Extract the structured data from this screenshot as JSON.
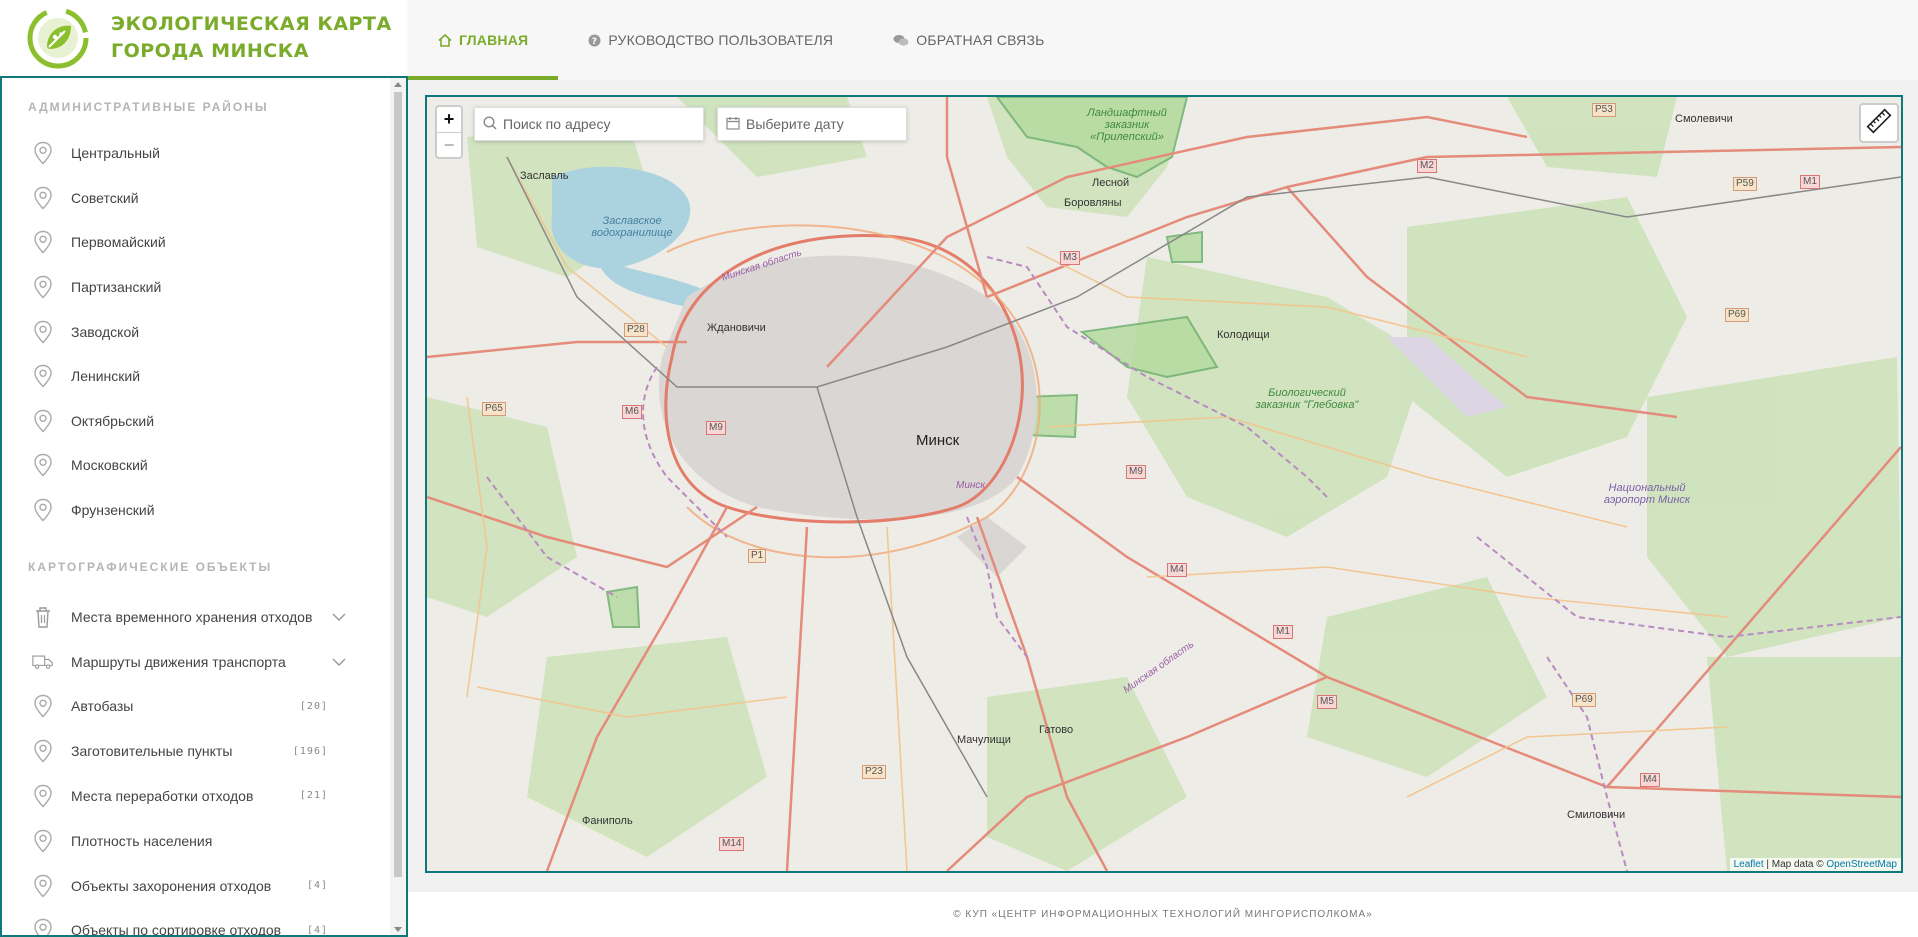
{
  "brand": {
    "title_line1": "ЭКОЛОГИЧЕСКАЯ КАРТА",
    "title_line2": "ГОРОДА МИНСКА",
    "accent_color": "#7bab2a",
    "frame_color": "#11787a"
  },
  "nav": {
    "tabs": [
      {
        "label": "ГЛАВНАЯ",
        "icon": "home-icon",
        "active": true
      },
      {
        "label": "РУКОВОДСТВО ПОЛЬЗОВАТЕЛЯ",
        "icon": "help-circle-icon",
        "active": false
      },
      {
        "label": "ОБРАТНАЯ СВЯЗЬ",
        "icon": "chat-bubbles-icon",
        "active": false
      }
    ]
  },
  "sidebar": {
    "districts_header": "АДМИНИСТРАТИВНЫЕ РАЙОНЫ",
    "districts": [
      {
        "label": "Центральный"
      },
      {
        "label": "Советский"
      },
      {
        "label": "Первомайский"
      },
      {
        "label": "Партизанский"
      },
      {
        "label": "Заводской"
      },
      {
        "label": "Ленинский"
      },
      {
        "label": "Октябрьский"
      },
      {
        "label": "Московский"
      },
      {
        "label": "Фрунзенский"
      }
    ],
    "objects_header": "КАРТОГРАФИЧЕСКИЕ ОБЪЕКТЫ",
    "objects": [
      {
        "label": "Места временного хранения отходов",
        "count": "",
        "icon": "trash-icon",
        "expandable": true
      },
      {
        "label": "Маршруты движения транспорта",
        "count": "",
        "icon": "truck-icon",
        "expandable": true
      },
      {
        "label": "Автобазы",
        "count": "[20]",
        "icon": "pin-icon",
        "expandable": false
      },
      {
        "label": "Заготовительные пункты",
        "count": "[196]",
        "icon": "pin-icon",
        "expandable": false
      },
      {
        "label": "Места переработки отходов",
        "count": "[21]",
        "icon": "pin-icon",
        "expandable": false
      },
      {
        "label": "Плотность населения",
        "count": "",
        "icon": "pin-icon",
        "expandable": false
      },
      {
        "label": "Объекты захоронения отходов",
        "count": "[4]",
        "icon": "pin-icon",
        "expandable": false
      },
      {
        "label": "Объекты по сортировке отходов",
        "count": "[4]",
        "icon": "pin-icon",
        "expandable": false
      }
    ]
  },
  "map": {
    "zoom_in": "+",
    "zoom_out": "−",
    "search_placeholder": "Поиск по адресу",
    "date_placeholder": "Выберите дату",
    "attribution_leaflet": "Leaflet",
    "attribution_sep": " | Map data © ",
    "attribution_osm": "OpenStreetMap",
    "labels": {
      "minsk": "Минск",
      "minsk_small": "Минск",
      "zaslavl": "Заславль",
      "reservoir": "Заславское водохранилище",
      "minsk_oblast_1": "Минская область",
      "minsk_oblast_2": "Минская область",
      "zhdanovichi": "Ждановичи",
      "lesnoy": "Лесной",
      "borovlyany": "Боровляны",
      "kolodishchi": "Колодищи",
      "smolevichi": "Смолевичи",
      "prilepsky": "Ландшафтный заказник «Прилепский»",
      "glebovka": "Биологический заказник \"Глебовка\"",
      "airport": "Национальный аэропорт Минск",
      "machulishchi": "Мачулищи",
      "gatovo": "Гатово",
      "fanipol": "Фаниполь",
      "smilovichi": "Смиловичи"
    },
    "shields": {
      "p53": "P53",
      "m2": "M2",
      "p59": "P59",
      "m1_top": "M1",
      "m3": "M3",
      "p28": "P28",
      "p69_top": "P69",
      "p65": "P65",
      "m6": "M6",
      "m9_left": "M9",
      "m9_right": "M9",
      "p1": "P1",
      "m4_mid": "M4",
      "m1_bottom": "M1",
      "m5": "M5",
      "p23": "P23",
      "p69_bottom": "P69",
      "m4_right": "M4",
      "m14": "M14"
    }
  },
  "footer": {
    "text": "© КУП «ЦЕНТР ИНФОРМАЦИОННЫХ ТЕХНОЛОГИЙ МИНГОРИСПОЛКОМА»"
  }
}
